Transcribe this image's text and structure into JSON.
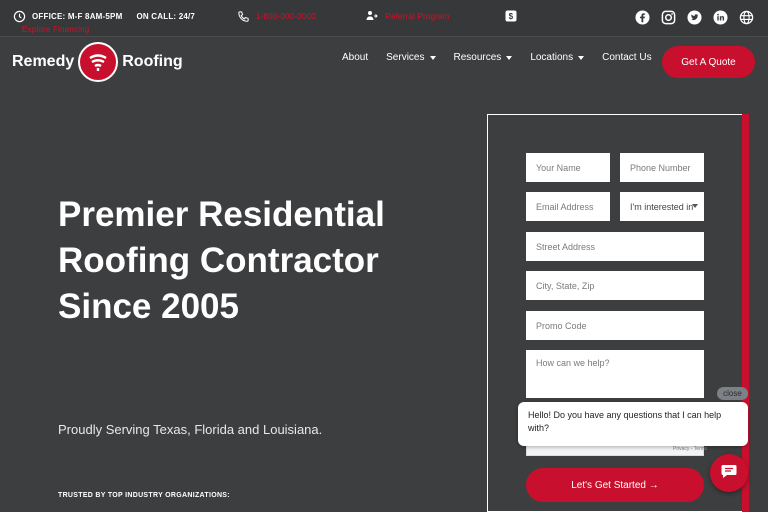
{
  "topbar": {
    "office": "OFFICE: M-F 8AM-5PM",
    "on_call": "ON CALL: 24/7",
    "phone_label": "1-800-000-0000",
    "referral_label": "Referral Program",
    "financing_label": "Explore Financing"
  },
  "social_icons": [
    "facebook-icon",
    "instagram-icon",
    "twitter-icon",
    "linkedin-icon",
    "globe-icon"
  ],
  "brand": {
    "left": "Remedy",
    "right": "Roofing",
    "accent": "#c8102e"
  },
  "nav": {
    "about": "About",
    "services": "Services",
    "resources": "Resources",
    "locations": "Locations",
    "contact": "Contact Us",
    "quote_button": "Get A Quote"
  },
  "hero": {
    "title": "Premier Residential Roofing Contractor Since 2005",
    "subtitle": "Proudly Serving Texas, Florida and Louisiana.",
    "trusted": "TRUSTED BY TOP INDUSTRY ORGANIZATIONS:"
  },
  "form": {
    "name_placeholder": "Your Name",
    "phone_placeholder": "Phone Number",
    "email_placeholder": "Email Address",
    "interest_value": "I'm interested in",
    "street_placeholder": "Street Address",
    "city_placeholder": "City, State, Zip",
    "promo_placeholder": "Promo Code",
    "message_placeholder": "How can we help?",
    "privacy": "Privacy - Terms",
    "submit": "Let's Get Started →"
  },
  "chat": {
    "close_label": "close",
    "message": "Hello! Do you have any questions that I can help with?"
  }
}
